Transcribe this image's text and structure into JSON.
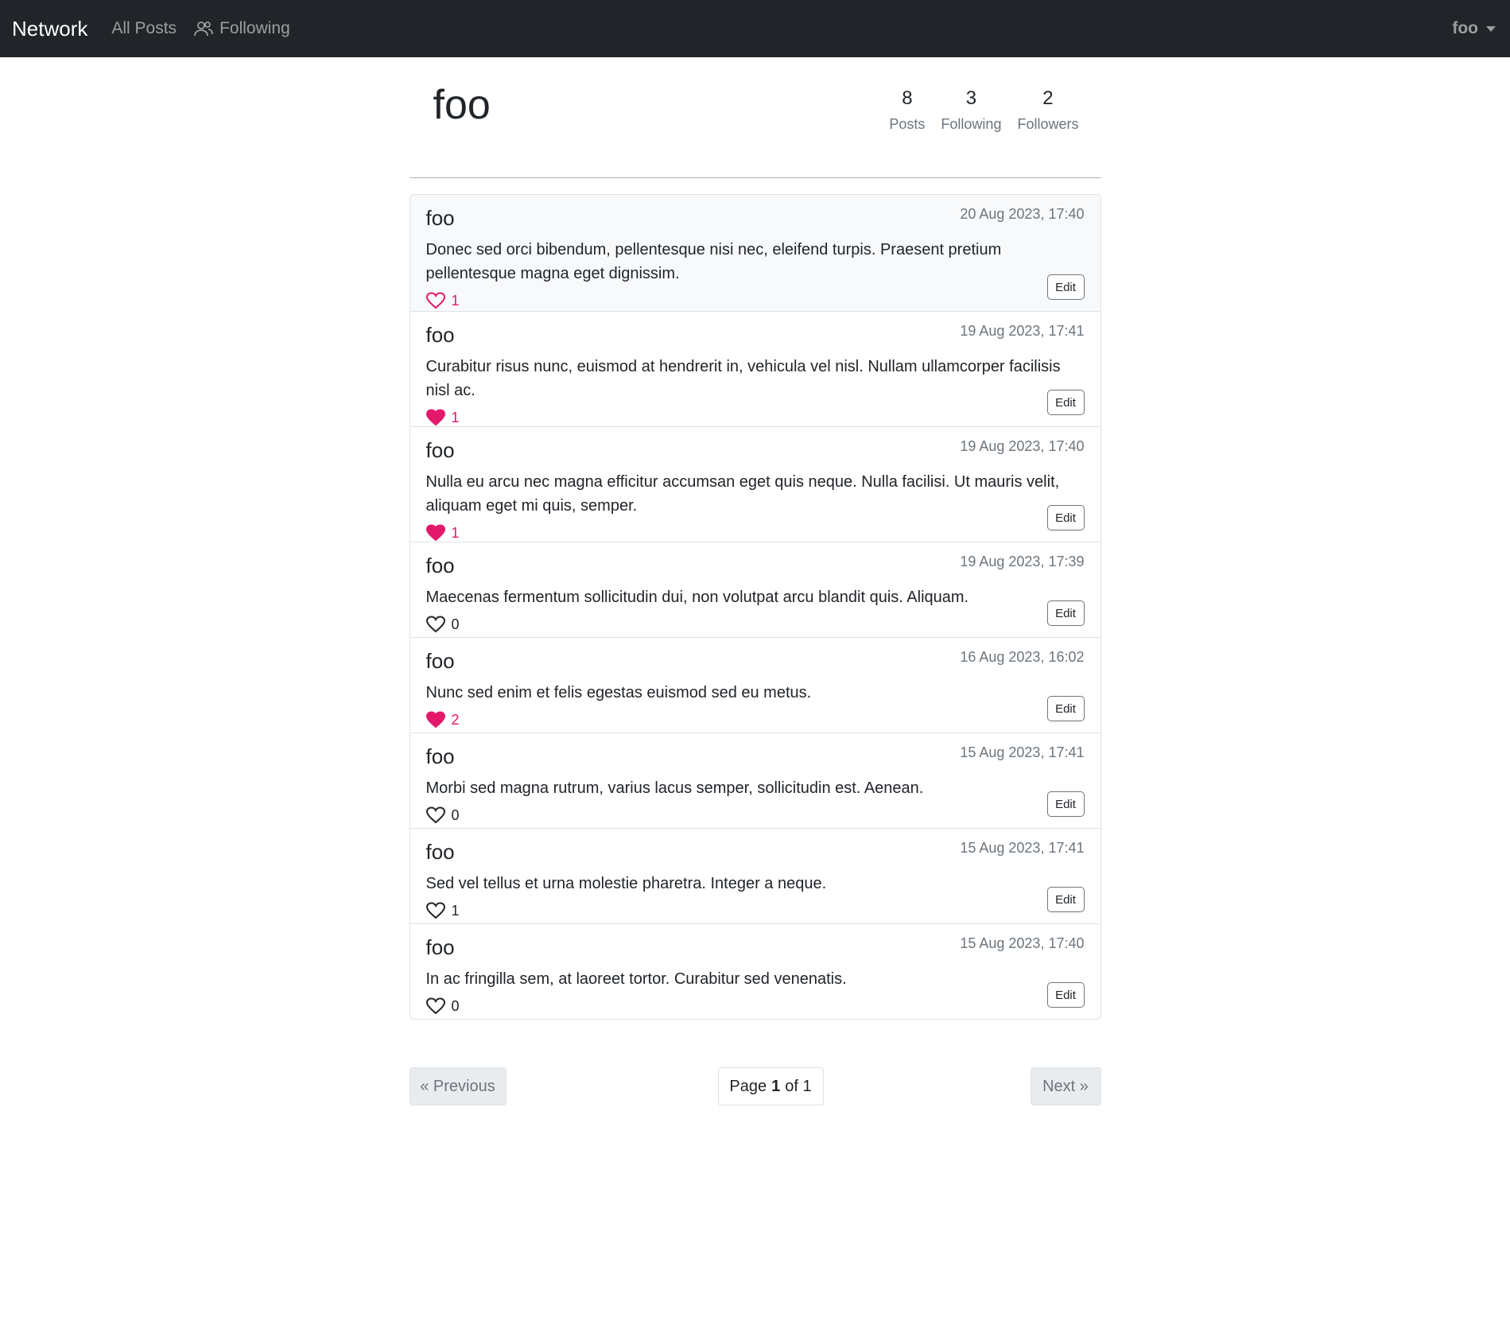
{
  "navbar": {
    "brand": "Network",
    "all_posts": "All Posts",
    "following": "Following",
    "following_icon": "people-icon",
    "user": "foo"
  },
  "profile": {
    "name": "foo",
    "stats": [
      {
        "value": "8",
        "label": "Posts"
      },
      {
        "value": "3",
        "label": "Following"
      },
      {
        "value": "2",
        "label": "Followers"
      }
    ]
  },
  "posts": [
    {
      "user": "foo",
      "time": "20 Aug 2023, 17:40",
      "body": "Donec sed orci bibendum, pellentesque nisi nec, eleifend turpis. Praesent pretium pellentesque magna eget dignissim.",
      "likes": "1",
      "heart": "heart-outline-pink",
      "edit": "Edit"
    },
    {
      "user": "foo",
      "time": "19 Aug 2023, 17:41",
      "body": "Curabitur risus nunc, euismod at hendrerit in, vehicula vel nisl. Nullam ullamcorper facilisis nisl ac.",
      "likes": "1",
      "heart": "heart-filled-pink",
      "edit": "Edit"
    },
    {
      "user": "foo",
      "time": "19 Aug 2023, 17:40",
      "body": "Nulla eu arcu nec magna efficitur accumsan eget quis neque. Nulla facilisi. Ut mauris velit, aliquam eget mi quis, semper.",
      "likes": "1",
      "heart": "heart-filled-pink",
      "edit": "Edit"
    },
    {
      "user": "foo",
      "time": "19 Aug 2023, 17:39",
      "body": "Maecenas fermentum sollicitudin dui, non volutpat arcu blandit quis. Aliquam.",
      "likes": "0",
      "heart": "heart-outline-dark",
      "edit": "Edit"
    },
    {
      "user": "foo",
      "time": "16 Aug 2023, 16:02",
      "body": "Nunc sed enim et felis egestas euismod sed eu metus.",
      "likes": "2",
      "heart": "heart-filled-pink",
      "edit": "Edit"
    },
    {
      "user": "foo",
      "time": "15 Aug 2023, 17:41",
      "body": "Morbi sed magna rutrum, varius lacus semper, sollicitudin est. Aenean.",
      "likes": "0",
      "heart": "heart-outline-dark",
      "edit": "Edit"
    },
    {
      "user": "foo",
      "time": "15 Aug 2023, 17:41",
      "body": "Sed vel tellus et urna molestie pharetra. Integer a neque.",
      "likes": "1",
      "heart": "heart-outline-dark",
      "edit": "Edit"
    },
    {
      "user": "foo",
      "time": "15 Aug 2023, 17:40",
      "body": "In ac fringilla sem, at laoreet tortor. Curabitur sed venenatis.",
      "likes": "0",
      "heart": "heart-outline-dark",
      "edit": "Edit"
    }
  ],
  "pagination": {
    "previous": "« Previous",
    "page_prefix": "Page",
    "current": "1",
    "of": "of",
    "total": "1",
    "next": "Next »"
  },
  "colors": {
    "navbar_bg": "#212529",
    "like_pink": "#e4186b"
  }
}
